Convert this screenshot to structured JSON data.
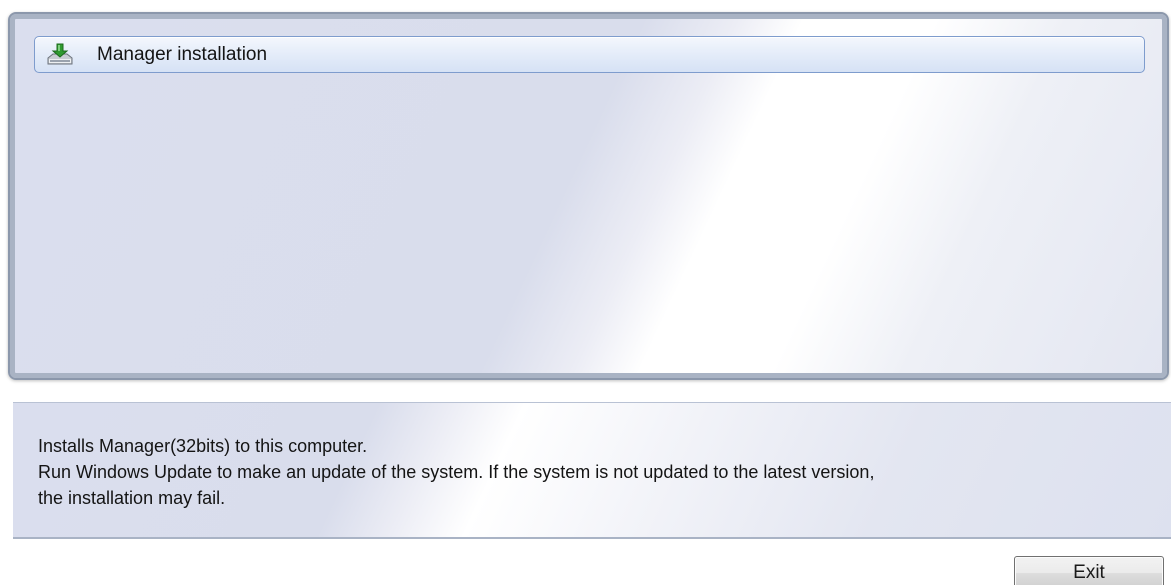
{
  "items": [
    {
      "label": "Manager installation",
      "icon": "install-download-icon",
      "selected": true
    }
  ],
  "description": {
    "lines": [
      "Installs Manager(32bits) to this computer.",
      "Run Windows Update to make an update of the system. If the system is not updated to the latest version,",
      "the installation may fail."
    ]
  },
  "buttons": {
    "exit_label": "Exit"
  },
  "colors": {
    "icon_arrow": "#2f9a2f",
    "icon_tray": "#c8ccd2",
    "selection_border": "#7e9ccd"
  }
}
